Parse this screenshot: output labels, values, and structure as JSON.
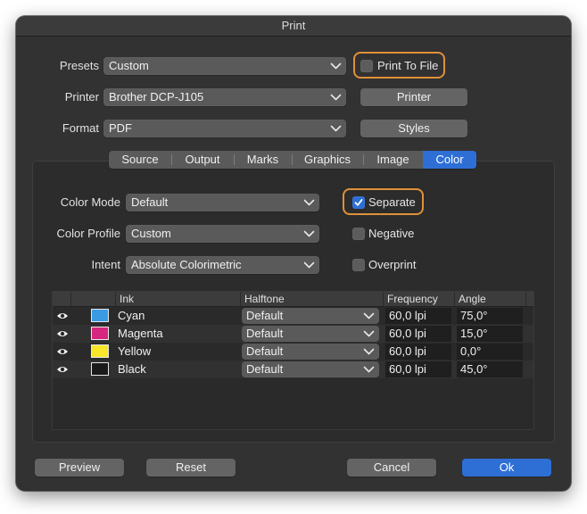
{
  "window": {
    "title": "Print"
  },
  "presets": {
    "label": "Presets",
    "value": "Custom"
  },
  "print_to_file": {
    "label": "Print To File",
    "checked": false
  },
  "printer": {
    "label": "Printer",
    "value": "Brother DCP-J105",
    "button": "Printer"
  },
  "format": {
    "label": "Format",
    "value": "PDF",
    "button": "Styles"
  },
  "tabs": [
    {
      "label": "Source",
      "active": false
    },
    {
      "label": "Output",
      "active": false
    },
    {
      "label": "Marks",
      "active": false
    },
    {
      "label": "Graphics",
      "active": false
    },
    {
      "label": "Image",
      "active": false
    },
    {
      "label": "Color",
      "active": true
    }
  ],
  "color_mode": {
    "label": "Color Mode",
    "value": "Default"
  },
  "color_profile": {
    "label": "Color Profile",
    "value": "Custom"
  },
  "intent": {
    "label": "Intent",
    "value": "Absolute Colorimetric"
  },
  "options": {
    "separate": {
      "label": "Separate",
      "checked": true
    },
    "negative": {
      "label": "Negative",
      "checked": false
    },
    "overprint": {
      "label": "Overprint",
      "checked": false
    }
  },
  "ink_table": {
    "headers": {
      "ink": "Ink",
      "halftone": "Halftone",
      "frequency": "Frequency",
      "angle": "Angle"
    },
    "rows": [
      {
        "ink": "Cyan",
        "swatch": "#3a9be3",
        "halftone": "Default",
        "frequency": "60,0 lpi",
        "angle": "75,0°"
      },
      {
        "ink": "Magenta",
        "swatch": "#d6277f",
        "halftone": "Default",
        "frequency": "60,0 lpi",
        "angle": "15,0°"
      },
      {
        "ink": "Yellow",
        "swatch": "#f7e62a",
        "halftone": "Default",
        "frequency": "60,0 lpi",
        "angle": "0,0°"
      },
      {
        "ink": "Black",
        "swatch": "#1a1a1a",
        "halftone": "Default",
        "frequency": "60,0 lpi",
        "angle": "45,0°"
      }
    ]
  },
  "footer": {
    "preview": "Preview",
    "reset": "Reset",
    "cancel": "Cancel",
    "ok": "Ok"
  },
  "colors": {
    "accent": "#2e6fd6",
    "focus": "#e0913a",
    "window_bg": "#323232"
  }
}
